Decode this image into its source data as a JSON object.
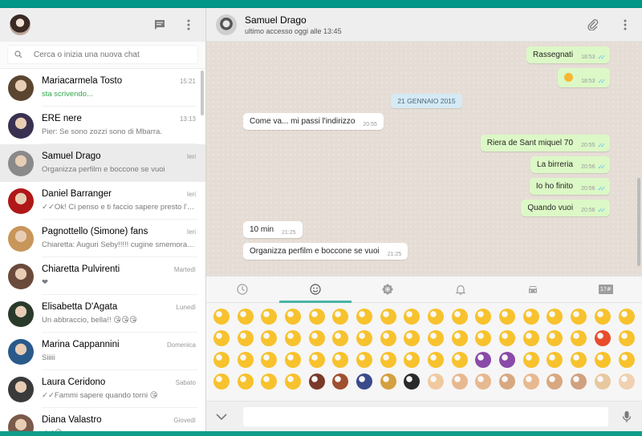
{
  "sidebar": {
    "search_placeholder": "Cerca o inizia una nuova chat",
    "chats": [
      {
        "name": "Mariacarmela Tosto",
        "time": "15:21",
        "last": "sta scrivendo...",
        "typing": true,
        "avatar_color": "#5a4630"
      },
      {
        "name": "ERE nere",
        "time": "13:13",
        "last": "Pier: Se sono zozzi sono di Mbarra.",
        "avatar_color": "#3a3050"
      },
      {
        "name": "Samuel Drago",
        "time": "Ieri",
        "last": "Organizza perfilm e boccone se vuoi",
        "active": true,
        "avatar_color": "#8a8a8a"
      },
      {
        "name": "Daniel Barranger",
        "time": "Ieri",
        "last": "✓✓Ok! Ci penso e ti faccio sapere presto l'ide...",
        "avatar_color": "#b01818"
      },
      {
        "name": "Pagnottello (Simone) fans",
        "time": "Ieri",
        "last": "Chiaretta: Auguri Seby!!!!! cugine smemorate ...",
        "avatar_color": "#c8955a"
      },
      {
        "name": "Chiaretta Pulvirenti",
        "time": "Martedì",
        "last": "❤",
        "avatar_color": "#6a4a3a"
      },
      {
        "name": "Elisabetta D'Agata",
        "time": "Lunedì",
        "last": "Un abbraccio, bella!! 😘😘😘",
        "avatar_color": "#2a3a2a"
      },
      {
        "name": "Marina Cappannini",
        "time": "Domenica",
        "last": "Siiiii",
        "avatar_color": "#2a5a8a"
      },
      {
        "name": "Laura Ceridono",
        "time": "Sabato",
        "last": "✓✓Fammi sapere quando torni 😘",
        "avatar_color": "#3a3a3a"
      },
      {
        "name": "Diana Valastro",
        "time": "Giovedì",
        "last": "✓✓😘",
        "avatar_color": "#7a5a4a"
      }
    ]
  },
  "conversation": {
    "contact_name": "Samuel Drago",
    "contact_status": "ultimo accesso oggi alle 13:45",
    "messages": [
      {
        "dir": "out",
        "text": "Rassegnati",
        "time": "18:53",
        "read": true
      },
      {
        "dir": "out",
        "emoji": "face-emoji",
        "time": "18:53",
        "read": true
      },
      {
        "dir": "date",
        "text": "21 GENNAIO 2015"
      },
      {
        "dir": "in",
        "text": "Come va... mi passi l'indirizzo",
        "time": "20:55"
      },
      {
        "dir": "out",
        "text": "Riera de Sant miquel 70",
        "time": "20:55",
        "read": true
      },
      {
        "dir": "out",
        "text": "La birreria",
        "time": "20:56",
        "read": true
      },
      {
        "dir": "out",
        "text": "Io ho finito",
        "time": "20:56",
        "read": true
      },
      {
        "dir": "out",
        "text": "Quando vuoi",
        "time": "20:56",
        "read": true
      },
      {
        "dir": "in",
        "text": "10 min",
        "time": "21:25"
      },
      {
        "dir": "in",
        "text": "Organizza perfilm e boccone se vuoi",
        "time": "21:25"
      }
    ]
  },
  "emoji_panel": {
    "tabs": [
      "recent-icon",
      "smiley-icon",
      "flower-icon",
      "bell-icon",
      "car-icon",
      "symbols-icon"
    ],
    "active_tab": 1,
    "symbols_tab_label": "1?#",
    "emoji_colors": [
      "#f7c22d",
      "#f7c22d",
      "#f7c22d",
      "#f7c22d",
      "#f7c22d",
      "#f7c22d",
      "#f7c22d",
      "#f7c22d",
      "#f7c22d",
      "#f7c22d",
      "#f7c22d",
      "#f7c22d",
      "#f7c22d",
      "#f7c22d",
      "#f7c22d",
      "#f7c22d",
      "#f7c22d",
      "#f7c22d",
      "#f7c22d",
      "#f7c22d",
      "#f7c22d",
      "#f7c22d",
      "#f7c22d",
      "#f7c22d",
      "#f7c22d",
      "#f7c22d",
      "#f7c22d",
      "#f7c22d",
      "#f7c22d",
      "#f7c22d",
      "#f7c22d",
      "#f7c22d",
      "#f7c22d",
      "#f7c22d",
      "#e84b2b",
      "#f7c22d",
      "#f7c22d",
      "#f7c22d",
      "#f7c22d",
      "#f7c22d",
      "#f7c22d",
      "#f7c22d",
      "#f7c22d",
      "#f7c22d",
      "#f7c22d",
      "#f7c22d",
      "#f7c22d",
      "#8a4ba8",
      "#8a4ba8",
      "#f7c22d",
      "#f7c22d",
      "#f7c22d",
      "#f7c22d",
      "#f7c22d",
      "#f7c22d",
      "#f7c22d",
      "#f7c22d",
      "#f7c22d",
      "#7a3a2a",
      "#a05030",
      "#3a4a8a",
      "#d4a040",
      "#2a2a2a",
      "#f1c9a0",
      "#e8b890",
      "#e8b890",
      "#d8a880",
      "#e8b890",
      "#d8a880",
      "#d0a080",
      "#e8c8a0",
      "#f0d0b0"
    ]
  },
  "composer": {
    "placeholder": ""
  }
}
